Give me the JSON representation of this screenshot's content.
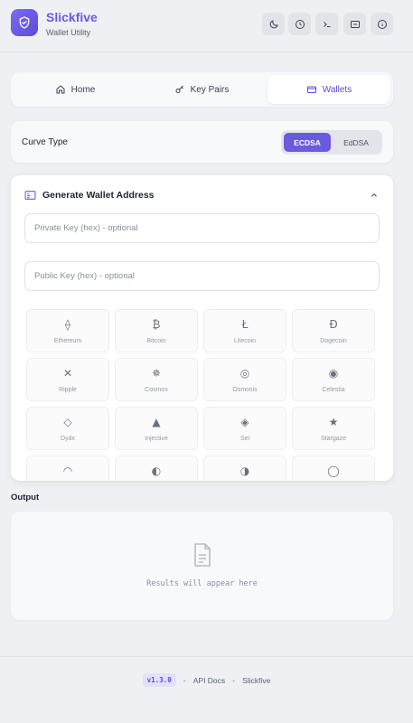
{
  "brand": {
    "name": "Slickfive",
    "subtitle": "Wallet Utility"
  },
  "header_buttons": [
    "moon-icon",
    "clock-icon",
    "terminal-icon",
    "panel-icon",
    "info-icon"
  ],
  "tabs": [
    {
      "label": "Home",
      "icon": "home-icon"
    },
    {
      "label": "Key Pairs",
      "icon": "key-icon"
    },
    {
      "label": "Wallets",
      "icon": "wallet-icon",
      "active": true
    }
  ],
  "curve": {
    "label": "Curve Type",
    "options": [
      "ECDSA",
      "EdDSA"
    ],
    "selected": "ECDSA"
  },
  "generator": {
    "title": "Generate Wallet Address",
    "private_key_placeholder": "Private Key (hex) - optional",
    "public_key_placeholder": "Public Key (hex) - optional",
    "coins": [
      {
        "name": "Ethereum",
        "glyph": "⟠"
      },
      {
        "name": "Bitcoin",
        "glyph": "₿"
      },
      {
        "name": "Litecoin",
        "glyph": "Ł"
      },
      {
        "name": "Dogecoin",
        "glyph": "Đ"
      },
      {
        "name": "Ripple",
        "glyph": "✕"
      },
      {
        "name": "Cosmos",
        "glyph": "✵"
      },
      {
        "name": "Osmosis",
        "glyph": "◎"
      },
      {
        "name": "Celestia",
        "glyph": "◉"
      },
      {
        "name": "Dydx",
        "glyph": "◇"
      },
      {
        "name": "Injective",
        "glyph": "▲"
      },
      {
        "name": "Sei",
        "glyph": "◈"
      },
      {
        "name": "Stargaze",
        "glyph": "★"
      },
      {
        "name": "",
        "glyph": "◠"
      },
      {
        "name": "",
        "glyph": "◐"
      },
      {
        "name": "",
        "glyph": "◑"
      },
      {
        "name": "",
        "glyph": "◯"
      }
    ]
  },
  "output": {
    "label": "Output",
    "placeholder": "Results will appear here"
  },
  "footer": {
    "version": "v1.3.0",
    "api_docs": "API Docs",
    "brand": "Slickfive"
  },
  "colors": {
    "accent": "#6a5ae0",
    "background": "#eef0f3"
  }
}
